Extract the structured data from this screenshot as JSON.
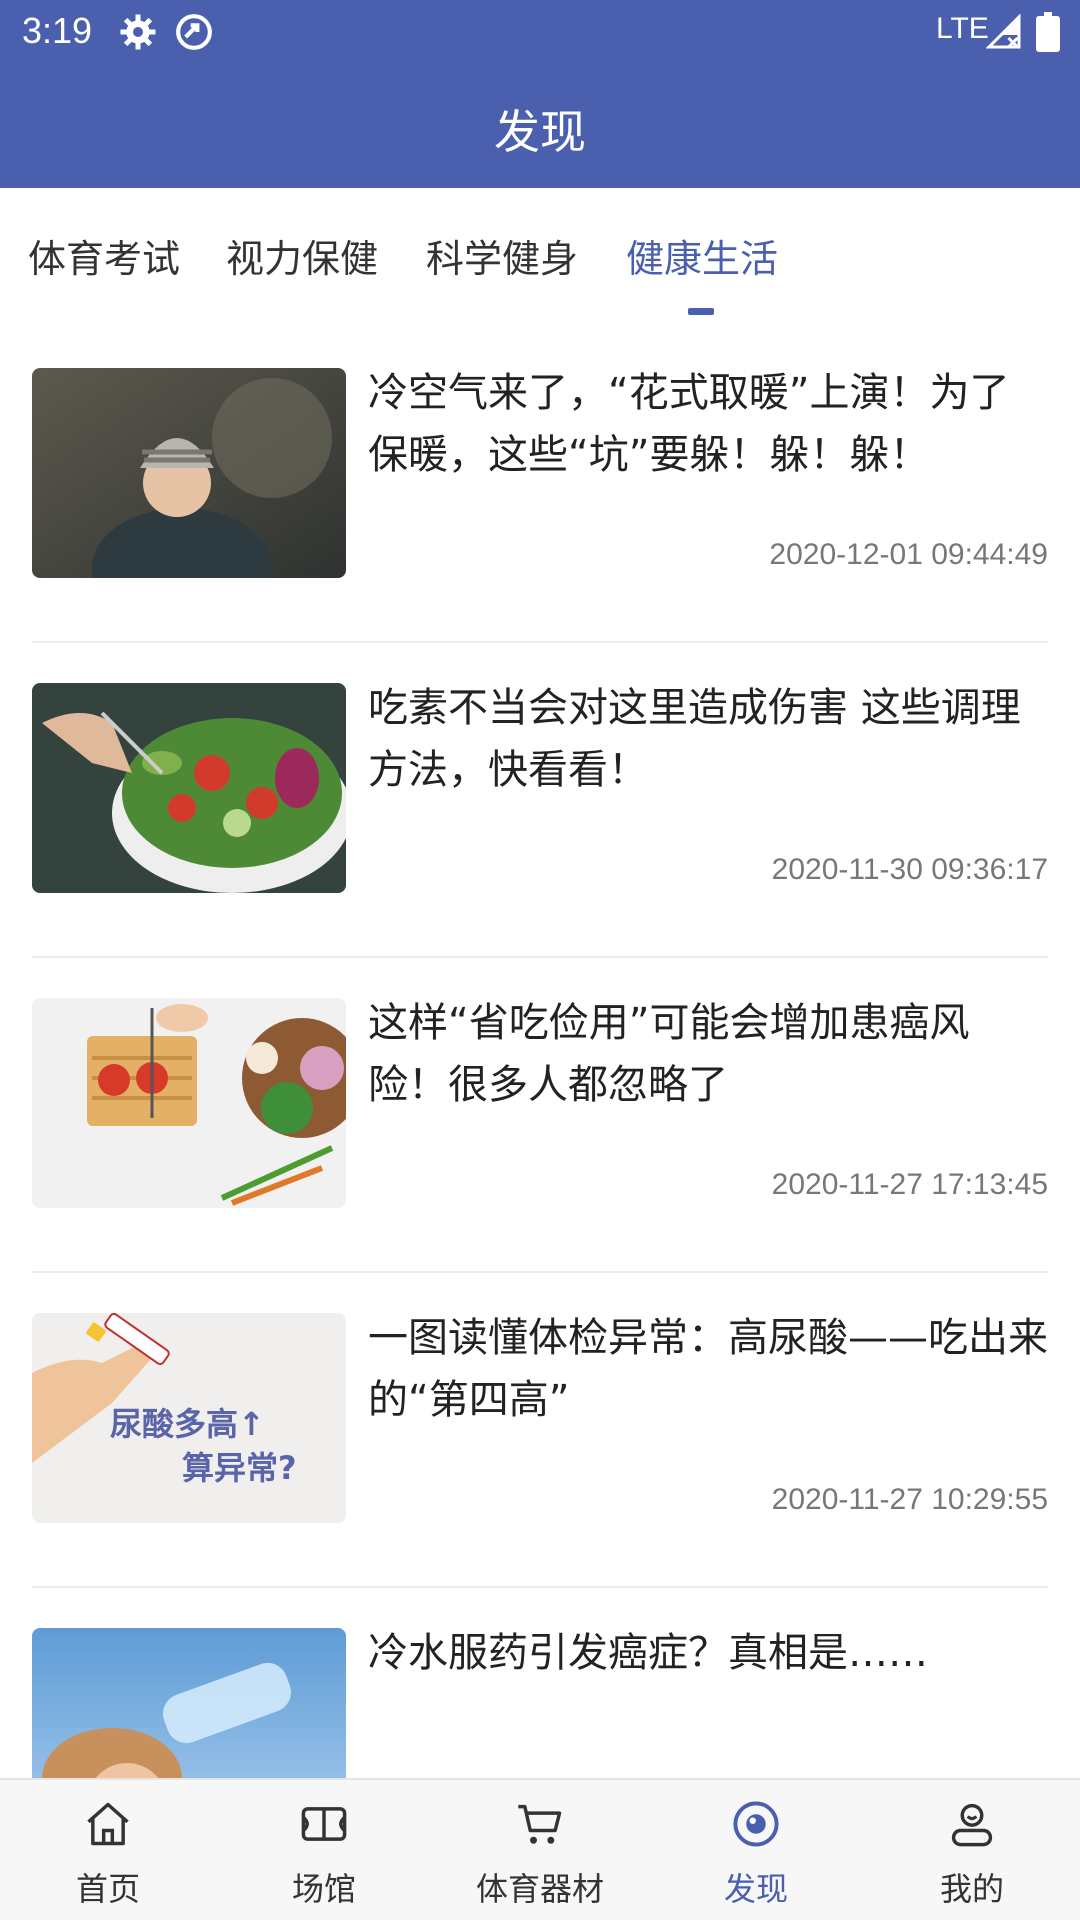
{
  "status_bar": {
    "time": "3:19",
    "network": "LTE"
  },
  "header": {
    "title": "发现"
  },
  "tabs": [
    {
      "label": "体育考试"
    },
    {
      "label": "视力保健"
    },
    {
      "label": "科学健身"
    },
    {
      "label": "健康生活",
      "active": true
    }
  ],
  "articles": [
    {
      "title": "冷空气来了，“花式取暖”上演！为了保暖，这些“坑”要躲！躲！躲！",
      "date": "2020-12-01 09:44:49"
    },
    {
      "title": "吃素不当会对这里造成伤害 这些调理方法，快看看！",
      "date": "2020-11-30 09:36:17"
    },
    {
      "title": "这样“省吃俭用”可能会增加患癌风险！很多人都忽略了",
      "date": "2020-11-27 17:13:45"
    },
    {
      "title": "一图读懂体检异常：高尿酸——吃出来的“第四高”",
      "date": "2020-11-27 10:29:55",
      "thumb_text_1": "尿酸多高↑",
      "thumb_text_2": "算异常?"
    },
    {
      "title": "冷水服药引发癌症？真相是……",
      "date": ""
    }
  ],
  "bottom_nav": [
    {
      "label": "首页",
      "icon": "home-icon"
    },
    {
      "label": "场馆",
      "icon": "stadium-icon"
    },
    {
      "label": "体育器材",
      "icon": "cart-icon"
    },
    {
      "label": "发现",
      "icon": "discover-icon",
      "active": true
    },
    {
      "label": "我的",
      "icon": "profile-icon"
    }
  ],
  "colors": {
    "primary": "#4a5fae",
    "text": "#222222",
    "muted": "#777777"
  }
}
